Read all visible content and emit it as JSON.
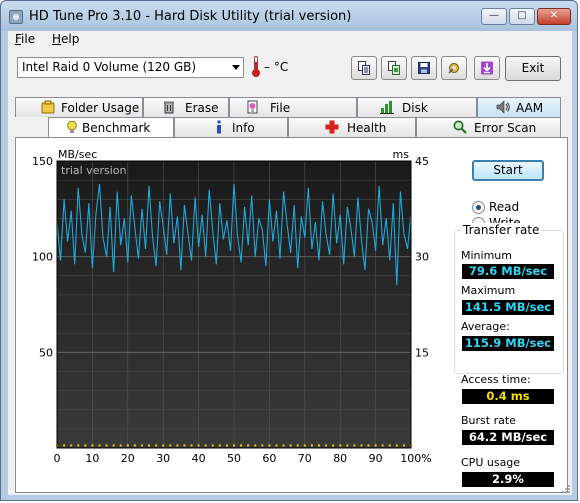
{
  "window": {
    "title": "HD Tune Pro 3.10 - Hard Disk Utility (trial version)"
  },
  "titlebar_buttons": {
    "minimize": "—",
    "maximize": "□",
    "close": "✕"
  },
  "menu": {
    "file_underline": "F",
    "file_rest": "ile",
    "help_underline": "H",
    "help_rest": "elp"
  },
  "toolbar": {
    "drive": "Intel   Raid 0 Volume (120 GB)",
    "temperature": "– °C",
    "exit_label": "Exit"
  },
  "tabs_top": [
    {
      "label": "Folder Usage",
      "icon": "folder-lock-icon"
    },
    {
      "label": "Erase",
      "icon": "trash-icon"
    },
    {
      "label": "File Benchmark",
      "icon": "file-benchmark-icon"
    },
    {
      "label": "Disk monitor",
      "icon": "bar-chart-icon"
    },
    {
      "label": "AAM",
      "icon": "speaker-icon"
    }
  ],
  "tabs_bottom": [
    {
      "label": "Benchmark",
      "icon": "lightbulb-icon"
    },
    {
      "label": "Info",
      "icon": "info-icon"
    },
    {
      "label": "Health",
      "icon": "health-cross-icon"
    },
    {
      "label": "Error Scan",
      "icon": "magnifier-icon"
    }
  ],
  "benchmark": {
    "start_label": "Start",
    "read_label": "Read",
    "write_label": "Write",
    "transfer_rate_title": "Transfer rate",
    "minimum_label": "Minimum",
    "minimum_value": "79.6 MB/sec",
    "maximum_label": "Maximum",
    "maximum_value": "141.5 MB/sec",
    "average_label": "Average:",
    "average_value": "115.9 MB/sec",
    "access_time_label": "Access time:",
    "access_time_value": "0.4 ms",
    "burst_rate_label": "Burst rate",
    "burst_rate_value": "64.2 MB/sec",
    "cpu_usage_label": "CPU usage",
    "cpu_usage_value": "2.9%"
  },
  "chart_data": {
    "type": "line",
    "watermark": "trial version",
    "ylabel": "MB/sec",
    "y2label": "ms",
    "ylim": [
      0,
      150
    ],
    "y2lim": [
      0,
      45
    ],
    "yticks": [
      "150",
      "100",
      "50"
    ],
    "y2ticks": [
      "45",
      "30",
      "15"
    ],
    "xticks": [
      "0",
      "10",
      "20",
      "30",
      "40",
      "50",
      "60",
      "70",
      "80",
      "90",
      "100%"
    ],
    "xlim": [
      0,
      100
    ],
    "transfer_min": 79.6,
    "transfer_max": 141.5,
    "transfer_avg": 115.9,
    "access_time_ms": 0.4,
    "series": [
      {
        "color": "#1fa9dc",
        "x": [
          0,
          1,
          2,
          3,
          4,
          5,
          6,
          7,
          8,
          9,
          10,
          11,
          12,
          13,
          14,
          15,
          16,
          17,
          18,
          19,
          20,
          21,
          22,
          23,
          24,
          25,
          26,
          27,
          28,
          29,
          30,
          31,
          32,
          33,
          34,
          35,
          36,
          37,
          38,
          39,
          40,
          41,
          42,
          43,
          44,
          45,
          46,
          47,
          48,
          49,
          50,
          51,
          52,
          53,
          54,
          55,
          56,
          57,
          58,
          59,
          60,
          61,
          62,
          63,
          64,
          65,
          66,
          67,
          68,
          69,
          70,
          71,
          72,
          73,
          74,
          75,
          76,
          77,
          78,
          79,
          80,
          81,
          82,
          83,
          84,
          85,
          86,
          87,
          88,
          89,
          90,
          91,
          92,
          93,
          94,
          95,
          96,
          97,
          98,
          99,
          100
        ],
        "values": [
          118,
          98,
          130,
          108,
          124,
          96,
          136,
          112,
          102,
          128,
          94,
          122,
          138,
          110,
          100,
          126,
          92,
          134,
          106,
          120,
          97,
          132,
          115,
          99,
          125,
          104,
          137,
          110,
          95,
          129,
          116,
          101,
          133,
          107,
          121,
          93,
          127,
          112,
          98,
          131,
          105,
          122,
          100,
          135,
          113,
          96,
          128,
          109,
          119,
          103,
          138,
          111,
          97,
          126,
          106,
          132,
          100,
          120,
          114,
          95,
          130,
          108,
          124,
          99,
          134,
          117,
          102,
          127,
          94,
          121,
          110,
          136,
          104,
          118,
          98,
          129,
          112,
          101,
          133,
          107,
          122,
          96,
          126,
          115,
          100,
          131,
          109,
          93,
          125,
          118,
          103,
          137,
          106,
          120,
          98,
          128,
          85,
          134,
          112,
          104,
          122
        ]
      },
      {
        "color": "#e8d400",
        "x": [
          0,
          2,
          4,
          6,
          8,
          10,
          12,
          14,
          16,
          18,
          20,
          22,
          24,
          26,
          28,
          30,
          32,
          34,
          36,
          38,
          40,
          42,
          44,
          46,
          48,
          50,
          52,
          54,
          56,
          58,
          60,
          62,
          64,
          66,
          68,
          70,
          72,
          74,
          76,
          78,
          80,
          82,
          84,
          86,
          88,
          90,
          92,
          94,
          96,
          98,
          100
        ],
        "values": [
          0.4,
          0.4,
          0.4,
          0.4,
          0.4,
          0.4,
          0.4,
          0.4,
          0.4,
          0.4,
          0.4,
          0.4,
          0.4,
          0.4,
          0.4,
          0.4,
          0.4,
          0.4,
          0.4,
          0.4,
          0.4,
          0.4,
          0.4,
          0.4,
          0.4,
          0.4,
          0.4,
          0.4,
          0.4,
          0.4,
          0.4,
          0.4,
          0.4,
          0.4,
          0.4,
          0.4,
          0.4,
          0.4,
          0.4,
          0.4,
          0.4,
          0.4,
          0.4,
          0.4,
          0.4,
          0.4,
          0.4,
          0.4,
          0.4,
          0.4,
          0.4
        ]
      }
    ]
  },
  "colors": {
    "transfer_line": "#1fa9dc",
    "access_dots": "#e8d400",
    "chart_bg": "#2a2a2a",
    "value_cyan": "#2fd6f5",
    "value_yellow": "#f2e200"
  }
}
